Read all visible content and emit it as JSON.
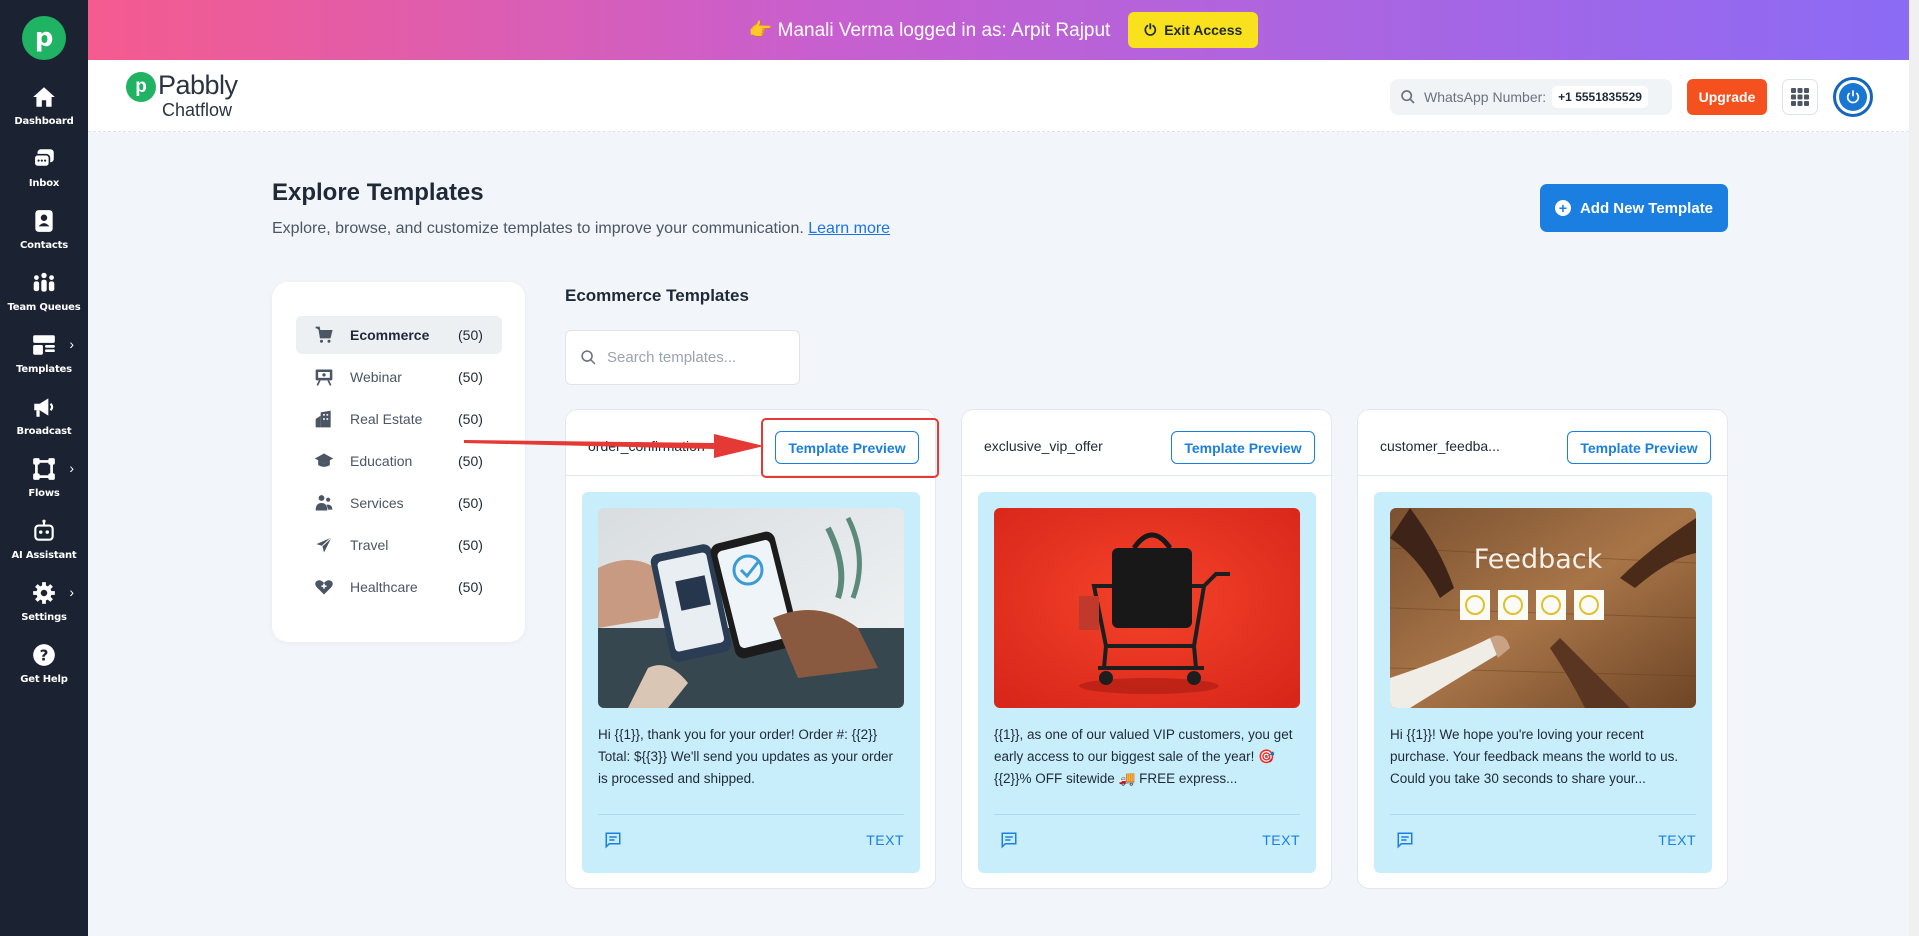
{
  "sidebar": {
    "items": [
      {
        "label": "Dashboard",
        "icon": "home-icon"
      },
      {
        "label": "Inbox",
        "icon": "inbox-icon"
      },
      {
        "label": "Contacts",
        "icon": "contacts-icon"
      },
      {
        "label": "Team Queues",
        "icon": "team-icon"
      },
      {
        "label": "Templates",
        "icon": "templates-icon"
      },
      {
        "label": "Broadcast",
        "icon": "megaphone-icon"
      },
      {
        "label": "Flows",
        "icon": "flows-icon"
      },
      {
        "label": "AI Assistant",
        "icon": "robot-icon"
      },
      {
        "label": "Settings",
        "icon": "gear-icon"
      },
      {
        "label": "Get Help",
        "icon": "help-icon"
      }
    ]
  },
  "banner": {
    "text": "👉 Manali Verma logged in as: Arpit Rajput",
    "exit_label": "Exit Access"
  },
  "header": {
    "brand_name": "Pabbly",
    "brand_sub": "Chatflow",
    "wa_label": "WhatsApp Number:",
    "wa_number": "+1 5551835529",
    "upgrade_label": "Upgrade"
  },
  "page": {
    "title": "Explore Templates",
    "subtitle": "Explore, browse, and customize templates to improve your communication.",
    "learn_more": "Learn more",
    "add_button": "Add New Template"
  },
  "categories": [
    {
      "name": "Ecommerce",
      "count": "(50)",
      "icon": "cart-icon",
      "active": true
    },
    {
      "name": "Webinar",
      "count": "(50)",
      "icon": "webinar-icon",
      "active": false
    },
    {
      "name": "Real Estate",
      "count": "(50)",
      "icon": "real-estate-icon",
      "active": false
    },
    {
      "name": "Education",
      "count": "(50)",
      "icon": "graduation-cap-icon",
      "active": false
    },
    {
      "name": "Services",
      "count": "(50)",
      "icon": "services-icon",
      "active": false
    },
    {
      "name": "Travel",
      "count": "(50)",
      "icon": "plane-icon",
      "active": false
    },
    {
      "name": "Healthcare",
      "count": "(50)",
      "icon": "heart-icon",
      "active": false
    }
  ],
  "templates": {
    "section_title": "Ecommerce Templates",
    "search_placeholder": "Search templates...",
    "preview_label": "Template Preview",
    "cards": [
      {
        "name": "order_confirmation",
        "text": "Hi {{1}}, thank you for your order! Order #: {{2}} Total: ${{3}} We'll send you updates as your order is processed and shipped.",
        "type": "TEXT",
        "image": "payment-phones-image"
      },
      {
        "name": "exclusive_vip_offer",
        "text": "{{1}}, as one of our valued VIP customers, you get early access to our biggest sale of the year! 🎯 {{2}}% OFF sitewide 🚚 FREE express...",
        "type": "TEXT",
        "image": "shopping-cart-image"
      },
      {
        "name": "customer_feedba...",
        "text": "Hi {{1}}! We hope you're loving your recent purchase. Your feedback means the world to us. Could you take 30 seconds to share your...",
        "type": "TEXT",
        "image": "feedback-image",
        "image_caption": "Feedback"
      }
    ]
  },
  "colors": {
    "sidebar_bg": "#1b2231",
    "accent": "#1a7fe0",
    "brand_green": "#20b363",
    "upgrade": "#f4511e",
    "exit_yellow": "#f9e11d",
    "card_body": "#c8eefb",
    "annotation_red": "#e53935"
  }
}
